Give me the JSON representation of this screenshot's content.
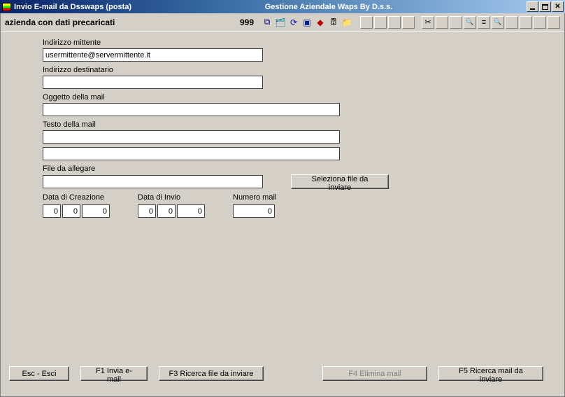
{
  "window": {
    "title_left": "Invio E-mail da Dsswaps  (posta)",
    "title_center": "Gestione Aziendale Waps By D.s.s."
  },
  "toolbar": {
    "company_label": "azienda con dati precaricati",
    "code": "999",
    "icons": {
      "save": "💾",
      "open": "📂",
      "refresh": "🔄",
      "pc": "🖥",
      "book": "📕",
      "help": "?",
      "folder": "📁"
    }
  },
  "form": {
    "sender_label": "Indirizzo mittente",
    "sender_value": "usermittente@servermittente.it",
    "dest_label": "Indirizzo destinatario",
    "dest_value": "",
    "subject_label": "Oggetto della mail",
    "subject_value": "",
    "body_label": "Testo della mail",
    "body_value1": "",
    "body_value2": "",
    "attach_label": "File da allegare",
    "attach_value": "",
    "select_file_btn": "Seleziona file da inviare",
    "created_label": "Data di Creazione",
    "sent_label": "Data di Invio",
    "mailnum_label": "Numero mail",
    "created": {
      "d": "0",
      "m": "0",
      "y": "0"
    },
    "sent": {
      "d": "0",
      "m": "0",
      "y": "0"
    },
    "mailnum": "0"
  },
  "buttons": {
    "esc": "Esc - Esci",
    "f1": "F1 Invia e-mail",
    "f3": "F3 Ricerca file da inviare",
    "f4": "F4 Elimina mail",
    "f5": "F5 Ricerca mail da inviare"
  }
}
